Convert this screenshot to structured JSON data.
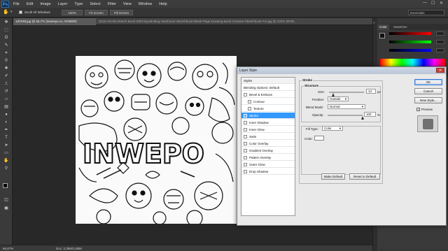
{
  "menubar": {
    "logo": "Ps",
    "items": [
      "File",
      "Edit",
      "Image",
      "Layer",
      "Type",
      "Select",
      "Filter",
      "View",
      "Window",
      "Help"
    ]
  },
  "options": {
    "scroll_all": "Scroll All Windows",
    "zoom_100": "100%",
    "fit_screen": "Fit Screen",
    "fill_screen": "Fill Screen",
    "workspace": "Essentials"
  },
  "document": {
    "tab": "1ZhSNl.jpg @ 66,7% (inweepo.co, RGB/8#)",
    "window_title": "2015-Hot-85-Sketch-Book-Stitching-Binding-Hardcover-Sketchbook-Blank-Page-Drawing-Book-Creative-Sketchbook-For.jpg @ 100% (RGB..."
  },
  "artwork": {
    "text": "INWEPO"
  },
  "status": {
    "zoom": "66,67%",
    "doc": "Doc: 2,39M/1,88M"
  },
  "panel": {
    "tabs": [
      "Color",
      "Swatches"
    ]
  },
  "dialog": {
    "title": "Layer Style",
    "styles_header": "Styles",
    "blending": "Blending Options: Default",
    "items": [
      {
        "label": "Bevel & Emboss",
        "checked": false,
        "indent": false,
        "selected": false
      },
      {
        "label": "Contour",
        "checked": false,
        "indent": true,
        "selected": false
      },
      {
        "label": "Texture",
        "checked": false,
        "indent": true,
        "selected": false
      },
      {
        "label": "Stroke",
        "checked": true,
        "indent": false,
        "selected": true
      },
      {
        "label": "Inner Shadow",
        "checked": false,
        "indent": false,
        "selected": false
      },
      {
        "label": "Inner Glow",
        "checked": false,
        "indent": false,
        "selected": false
      },
      {
        "label": "Satin",
        "checked": false,
        "indent": false,
        "selected": false
      },
      {
        "label": "Color Overlay",
        "checked": false,
        "indent": false,
        "selected": false
      },
      {
        "label": "Gradient Overlay",
        "checked": false,
        "indent": false,
        "selected": false
      },
      {
        "label": "Pattern Overlay",
        "checked": false,
        "indent": false,
        "selected": false
      },
      {
        "label": "Outer Glow",
        "checked": false,
        "indent": false,
        "selected": false
      },
      {
        "label": "Drop Shadow",
        "checked": false,
        "indent": false,
        "selected": false
      }
    ],
    "stroke_group": "Stroke",
    "structure_group": "Structure",
    "size_label": "Size:",
    "size_value": "13",
    "size_unit": "px",
    "position_label": "Position:",
    "position_value": "Outside",
    "blend_label": "Blend Mode:",
    "blend_value": "Normal",
    "opacity_label": "Opacity:",
    "opacity_value": "100",
    "opacity_unit": "%",
    "fill_type_label": "Fill Type:",
    "fill_type_value": "Color",
    "color_label": "Color:",
    "make_default": "Make Default",
    "reset_default": "Reset to Default",
    "ok": "OK",
    "cancel": "Cancel",
    "new_style": "New Style...",
    "preview": "Preview",
    "size_fraction": 0.12,
    "opacity_fraction": 1.0,
    "stroke_color": "#ffffff"
  }
}
